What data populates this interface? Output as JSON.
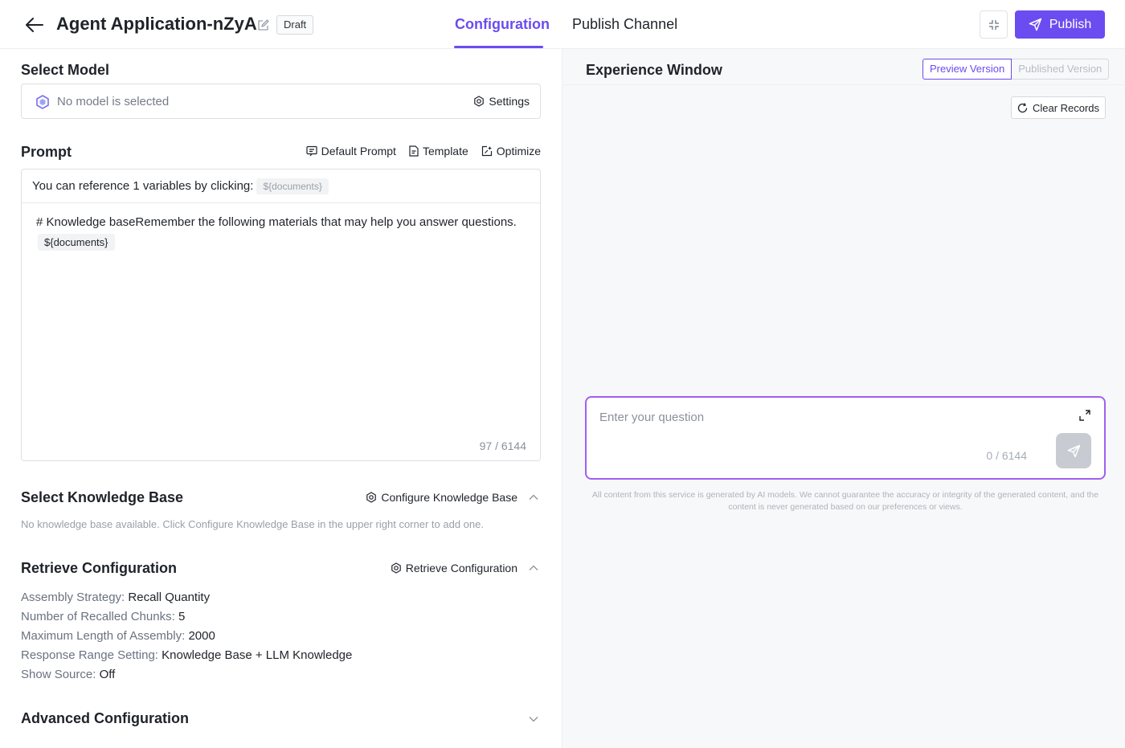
{
  "header": {
    "title": "Agent Application-nZyA",
    "status_badge": "Draft",
    "tabs": [
      {
        "label": "Configuration",
        "active": true
      },
      {
        "label": "Publish Channel",
        "active": false
      }
    ],
    "publish_label": "Publish",
    "accent_color": "#6b4cf0"
  },
  "select_model": {
    "title": "Select Model",
    "placeholder": "No model is selected",
    "settings_label": "Settings"
  },
  "prompt": {
    "title": "Prompt",
    "actions": {
      "default_prompt": "Default Prompt",
      "template": "Template",
      "optimize": "Optimize"
    },
    "reference_text": "You can reference 1 variables by clicking:",
    "reference_variable": "${documents}",
    "content": "# Knowledge baseRemember the following materials that may help you answer questions.",
    "content_variable": "${documents}",
    "char_count": "97 / 6144"
  },
  "knowledge_base": {
    "title": "Select Knowledge Base",
    "action_label": "Configure Knowledge Base",
    "empty_text": "No knowledge base available. Click Configure Knowledge Base in the upper right corner to add one."
  },
  "retrieve": {
    "title": "Retrieve Configuration",
    "action_label": "Retrieve Configuration",
    "items": [
      {
        "key": "Assembly Strategy:",
        "value": "Recall Quantity"
      },
      {
        "key": "Number of Recalled Chunks:",
        "value": "5"
      },
      {
        "key": "Maximum Length of Assembly:",
        "value": "2000"
      },
      {
        "key": "Response Range Setting:",
        "value": "Knowledge Base + LLM Knowledge"
      },
      {
        "key": "Show Source:",
        "value": "Off"
      }
    ]
  },
  "advanced": {
    "title": "Advanced Configuration"
  },
  "experience": {
    "title": "Experience Window",
    "preview_version": "Preview Version",
    "published_version": "Published Version",
    "clear_records": "Clear Records",
    "question_placeholder": "Enter your question",
    "question_count": "0 / 6144",
    "disclaimer": "All content from this service is generated by AI models. We cannot guarantee the accuracy or integrity of the generated content, and the content is never generated based on our preferences or views."
  }
}
